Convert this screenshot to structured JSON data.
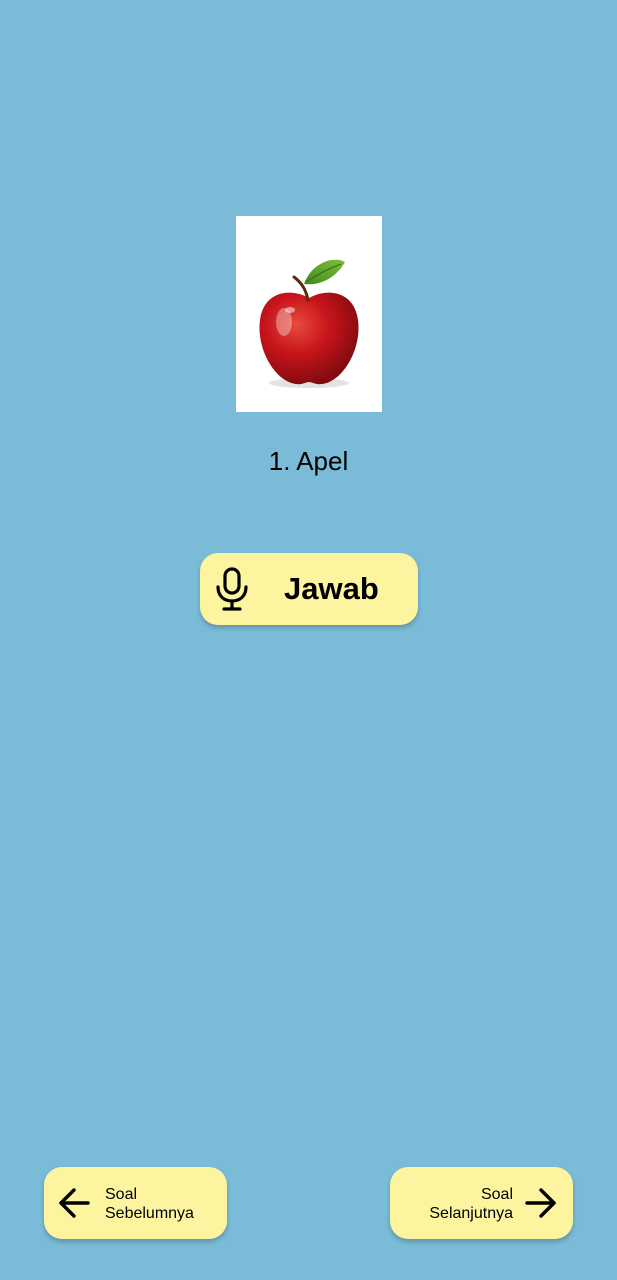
{
  "question": {
    "image_subject": "red apple",
    "label": "1. Apel"
  },
  "answer_button": {
    "icon": "microphone-icon",
    "label": "Jawab"
  },
  "navigation": {
    "prev": {
      "icon": "arrow-left-icon",
      "line1": "Soal",
      "line2": "Sebelumnya"
    },
    "next": {
      "icon": "arrow-right-icon",
      "line1": "Soal",
      "line2": "Selanjutnya"
    }
  },
  "colors": {
    "background": "#7abcd8",
    "button": "#fdf4a0",
    "text": "#000000"
  }
}
